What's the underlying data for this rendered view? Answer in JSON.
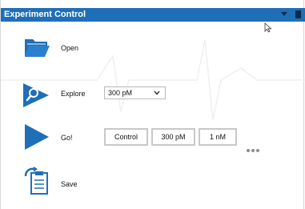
{
  "window": {
    "title": "Experiment Control"
  },
  "actions": {
    "open_label": "Open",
    "explore_label": "Explore",
    "go_label": "Go!",
    "save_label": "Save"
  },
  "explore_select": {
    "value": "300 pM"
  },
  "go_buttons": [
    {
      "label": "Control"
    },
    {
      "label": "300 pM"
    },
    {
      "label": "1 nM"
    }
  ],
  "colors": {
    "titlebar": "#1f6fb8",
    "icon_blue": "#1f6fb8"
  },
  "icons": [
    "folder-icon",
    "magnifier-icon",
    "play-icon",
    "clipboard-save-icon",
    "chevron-down-icon",
    "more-icon",
    "cursor-icon"
  ]
}
